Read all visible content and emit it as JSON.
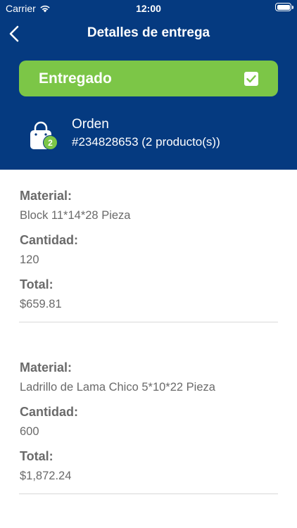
{
  "status_bar": {
    "carrier": "Carrier",
    "time": "12:00"
  },
  "nav": {
    "title": "Detalles de entrega"
  },
  "delivery_status": {
    "label": "Entregado",
    "checked": true,
    "color": "#7cc647"
  },
  "order": {
    "label": "Orden",
    "description": "#234828653 (2 producto(s))",
    "badge_count": "2"
  },
  "colors": {
    "header_bg": "#053a80",
    "accent": "#7cc647",
    "text_gray": "#6a6a6a"
  },
  "items": [
    {
      "material_label": "Material:",
      "material": "Block 11*14*28 Pieza",
      "quantity_label": "Cantidad:",
      "quantity": "120",
      "total_label": "Total:",
      "total": "$659.81"
    },
    {
      "material_label": "Material:",
      "material": "Ladrillo de Lama Chico 5*10*22 Pieza",
      "quantity_label": "Cantidad:",
      "quantity": "600",
      "total_label": "Total:",
      "total": "$1,872.24"
    }
  ]
}
